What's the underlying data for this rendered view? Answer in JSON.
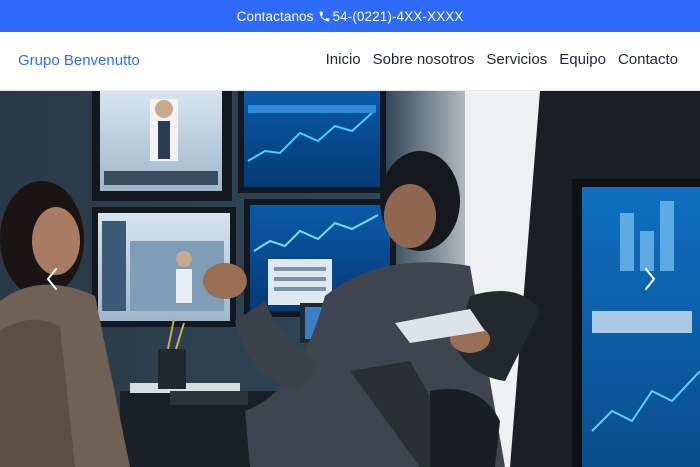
{
  "topbar": {
    "contact_label": "Contactanos",
    "phone": "54-(0221)-4XX-XXXX",
    "icon": "phone-icon",
    "background": "#2f6bfa"
  },
  "navbar": {
    "brand": "Grupo Benvenutto",
    "brand_color": "#2f6bfa",
    "items": [
      {
        "label": "Inicio"
      },
      {
        "label": "Sobre nosotros"
      },
      {
        "label": "Servicios"
      },
      {
        "label": "Equipo"
      },
      {
        "label": "Contacto"
      }
    ]
  },
  "hero": {
    "carousel_prev_icon": "chevron-left-icon",
    "carousel_next_icon": "chevron-right-icon"
  }
}
